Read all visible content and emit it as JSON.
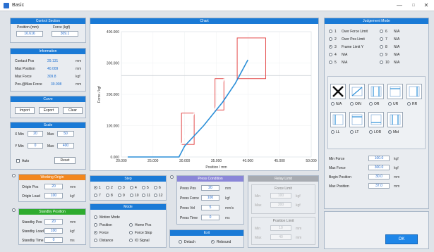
{
  "window": {
    "title": "Basic",
    "min": "—",
    "max": "□",
    "close": "✕"
  },
  "control_section": {
    "title": "Control Section",
    "col1": "Position (mm)",
    "col2": "Force (kgf)",
    "val1": "16.616",
    "val2": "309.1"
  },
  "information": {
    "title": "Information",
    "rows": [
      {
        "label": "Contact Pos",
        "value": "29.131",
        "unit": "mm"
      },
      {
        "label": "Max Position",
        "value": "40.009",
        "unit": "mm"
      },
      {
        "label": "Max Force",
        "value": "309.8",
        "unit": "kgf"
      },
      {
        "label": "Pos.@Max Force",
        "value": "39.908",
        "unit": "mm"
      }
    ]
  },
  "curve": {
    "title": "Curve",
    "buttons": [
      "Import",
      "Export",
      "Clear"
    ]
  },
  "scale": {
    "title": "Scale",
    "xmin_label": "X Min",
    "xmin": "20",
    "xmax_label": "Max",
    "xmax": "50",
    "ymin_label": "Y Min",
    "ymin": "0",
    "ymax_label": "Max",
    "ymax": "400",
    "auto_label": "Auto",
    "reset": "Reset"
  },
  "working_origin": {
    "title": "Working Origin",
    "rows": [
      {
        "label": "Origin Pos",
        "value": "20",
        "unit": "mm"
      },
      {
        "label": "Origin Load",
        "value": "100",
        "unit": "kgf"
      }
    ]
  },
  "standby_position": {
    "title": "Standby Position",
    "rows": [
      {
        "label": "Standby Pos",
        "value": "20",
        "unit": "mm"
      },
      {
        "label": "Standby Load",
        "value": "100",
        "unit": "kgf"
      },
      {
        "label": "Standby Time",
        "value": "0",
        "unit": "ms"
      }
    ]
  },
  "chart_title": "Chart",
  "chart_data": {
    "type": "line",
    "xlabel": "Position / mm",
    "ylabel": "Force / kgf",
    "xlim": [
      20,
      50
    ],
    "ylim": [
      0,
      400
    ],
    "xticks": [
      "20.000",
      "25.000",
      "30.000",
      "35.000",
      "40.000",
      "45.000",
      "50.000"
    ],
    "yticks": [
      "0.000",
      "100.000",
      "200.000",
      "300.000",
      "400.000"
    ],
    "series": [
      {
        "values": [
          [
            21,
            0
          ],
          [
            29.1,
            0
          ],
          [
            30,
            35
          ],
          [
            33,
            100
          ],
          [
            36,
            175
          ],
          [
            38,
            235
          ],
          [
            40,
            310
          ]
        ]
      }
    ],
    "reference_line": 260,
    "windows": [
      {
        "x": [
          29.5,
          31.5
        ],
        "y": [
          40,
          140
        ]
      },
      {
        "x": [
          34.8,
          36.2
        ],
        "y": [
          150,
          250
        ]
      },
      {
        "x": [
          38.3,
          42.8
        ],
        "y": [
          250,
          380
        ]
      }
    ],
    "ranges": [
      {
        "x": [
          29.5,
          31.5
        ],
        "y": [
          40,
          140
        ]
      },
      {
        "x": [
          34.8,
          36.2
        ],
        "y": [
          150,
          250
        ]
      }
    ]
  },
  "step": {
    "title": "Step",
    "options": [
      "1",
      "2",
      "3",
      "4",
      "5",
      "6",
      "7",
      "8",
      "9",
      "10",
      "11",
      "12"
    ],
    "selected": 0
  },
  "mode": {
    "title": "Mode",
    "options": [
      "Motion Mode",
      "Position",
      "Home Pos",
      "Force",
      "Force Stop",
      "Distance",
      "IO Signal"
    ],
    "selected": 3
  },
  "press_condition": {
    "title": "Press Condition",
    "rows": [
      {
        "label": "Press Pos",
        "value": "20",
        "unit": "mm"
      },
      {
        "label": "Press Force",
        "value": "100",
        "unit": "kgf"
      },
      {
        "label": "Press Vel",
        "value": "5",
        "unit": "mm/s"
      },
      {
        "label": "Press Time",
        "value": "0",
        "unit": "ms"
      }
    ]
  },
  "exit": {
    "title": "Exit",
    "options": [
      "Detach",
      "Rebound"
    ],
    "selected": 1
  },
  "relay": {
    "title": "Relay Limit",
    "g1": "Force Limit",
    "g2": "Position Limit",
    "min": "Min",
    "max": "Max",
    "f_min": "100",
    "f_max": "300",
    "p_min": "10",
    "p_max": "40",
    "unit_f": "kgf",
    "unit_p": "mm"
  },
  "judgement": {
    "title": "Judgement Mode",
    "rows": [
      {
        "num": "1",
        "label": "Over Force Limit",
        "num2": "6",
        "label2": "N/A",
        "sel": false
      },
      {
        "num": "2",
        "label": "Over Pos Limit",
        "num2": "7",
        "label2": "N/A",
        "sel": false
      },
      {
        "num": "3",
        "label": "Frame Limit Y",
        "num2": "8",
        "label2": "N/A",
        "sel": true
      },
      {
        "num": "4",
        "label": "N/A",
        "num2": "9",
        "label2": "N/A",
        "sel": false
      },
      {
        "num": "5",
        "label": "N/A",
        "num2": "10",
        "label2": "N/A",
        "sel": false
      }
    ],
    "icons_top": [
      "N/A",
      "OIN",
      "OR",
      "UR",
      "RR"
    ],
    "icons_bot": [
      "LL",
      "LT",
      "LOR",
      "Mid"
    ],
    "fields": [
      {
        "label": "Min Force",
        "value": "100.0",
        "unit": "kgf"
      },
      {
        "label": "Max Force",
        "value": "300.0",
        "unit": "kgf"
      },
      {
        "label": "Begin Position",
        "value": "30.0",
        "unit": "mm"
      },
      {
        "label": "Max Position",
        "value": "37.0",
        "unit": "mm"
      }
    ]
  },
  "ok_button": "OK"
}
